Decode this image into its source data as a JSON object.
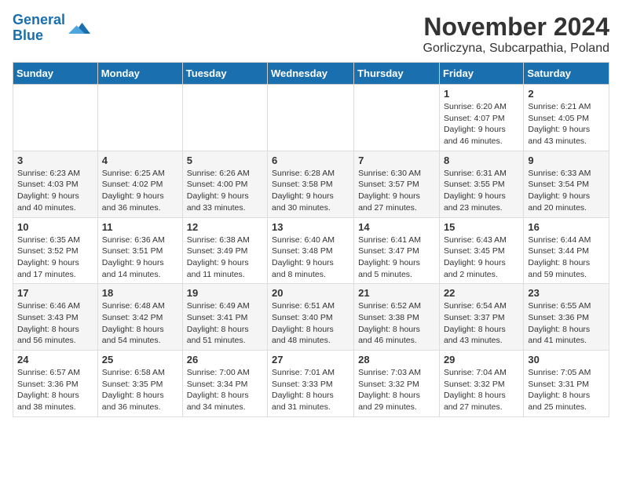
{
  "logo": {
    "line1": "General",
    "line2": "Blue"
  },
  "title": "November 2024",
  "subtitle": "Gorliczyna, Subcarpathia, Poland",
  "days_of_week": [
    "Sunday",
    "Monday",
    "Tuesday",
    "Wednesday",
    "Thursday",
    "Friday",
    "Saturday"
  ],
  "weeks": [
    [
      {
        "day": "",
        "info": ""
      },
      {
        "day": "",
        "info": ""
      },
      {
        "day": "",
        "info": ""
      },
      {
        "day": "",
        "info": ""
      },
      {
        "day": "",
        "info": ""
      },
      {
        "day": "1",
        "info": "Sunrise: 6:20 AM\nSunset: 4:07 PM\nDaylight: 9 hours and 46 minutes."
      },
      {
        "day": "2",
        "info": "Sunrise: 6:21 AM\nSunset: 4:05 PM\nDaylight: 9 hours and 43 minutes."
      }
    ],
    [
      {
        "day": "3",
        "info": "Sunrise: 6:23 AM\nSunset: 4:03 PM\nDaylight: 9 hours and 40 minutes."
      },
      {
        "day": "4",
        "info": "Sunrise: 6:25 AM\nSunset: 4:02 PM\nDaylight: 9 hours and 36 minutes."
      },
      {
        "day": "5",
        "info": "Sunrise: 6:26 AM\nSunset: 4:00 PM\nDaylight: 9 hours and 33 minutes."
      },
      {
        "day": "6",
        "info": "Sunrise: 6:28 AM\nSunset: 3:58 PM\nDaylight: 9 hours and 30 minutes."
      },
      {
        "day": "7",
        "info": "Sunrise: 6:30 AM\nSunset: 3:57 PM\nDaylight: 9 hours and 27 minutes."
      },
      {
        "day": "8",
        "info": "Sunrise: 6:31 AM\nSunset: 3:55 PM\nDaylight: 9 hours and 23 minutes."
      },
      {
        "day": "9",
        "info": "Sunrise: 6:33 AM\nSunset: 3:54 PM\nDaylight: 9 hours and 20 minutes."
      }
    ],
    [
      {
        "day": "10",
        "info": "Sunrise: 6:35 AM\nSunset: 3:52 PM\nDaylight: 9 hours and 17 minutes."
      },
      {
        "day": "11",
        "info": "Sunrise: 6:36 AM\nSunset: 3:51 PM\nDaylight: 9 hours and 14 minutes."
      },
      {
        "day": "12",
        "info": "Sunrise: 6:38 AM\nSunset: 3:49 PM\nDaylight: 9 hours and 11 minutes."
      },
      {
        "day": "13",
        "info": "Sunrise: 6:40 AM\nSunset: 3:48 PM\nDaylight: 9 hours and 8 minutes."
      },
      {
        "day": "14",
        "info": "Sunrise: 6:41 AM\nSunset: 3:47 PM\nDaylight: 9 hours and 5 minutes."
      },
      {
        "day": "15",
        "info": "Sunrise: 6:43 AM\nSunset: 3:45 PM\nDaylight: 9 hours and 2 minutes."
      },
      {
        "day": "16",
        "info": "Sunrise: 6:44 AM\nSunset: 3:44 PM\nDaylight: 8 hours and 59 minutes."
      }
    ],
    [
      {
        "day": "17",
        "info": "Sunrise: 6:46 AM\nSunset: 3:43 PM\nDaylight: 8 hours and 56 minutes."
      },
      {
        "day": "18",
        "info": "Sunrise: 6:48 AM\nSunset: 3:42 PM\nDaylight: 8 hours and 54 minutes."
      },
      {
        "day": "19",
        "info": "Sunrise: 6:49 AM\nSunset: 3:41 PM\nDaylight: 8 hours and 51 minutes."
      },
      {
        "day": "20",
        "info": "Sunrise: 6:51 AM\nSunset: 3:40 PM\nDaylight: 8 hours and 48 minutes."
      },
      {
        "day": "21",
        "info": "Sunrise: 6:52 AM\nSunset: 3:38 PM\nDaylight: 8 hours and 46 minutes."
      },
      {
        "day": "22",
        "info": "Sunrise: 6:54 AM\nSunset: 3:37 PM\nDaylight: 8 hours and 43 minutes."
      },
      {
        "day": "23",
        "info": "Sunrise: 6:55 AM\nSunset: 3:36 PM\nDaylight: 8 hours and 41 minutes."
      }
    ],
    [
      {
        "day": "24",
        "info": "Sunrise: 6:57 AM\nSunset: 3:36 PM\nDaylight: 8 hours and 38 minutes."
      },
      {
        "day": "25",
        "info": "Sunrise: 6:58 AM\nSunset: 3:35 PM\nDaylight: 8 hours and 36 minutes."
      },
      {
        "day": "26",
        "info": "Sunrise: 7:00 AM\nSunset: 3:34 PM\nDaylight: 8 hours and 34 minutes."
      },
      {
        "day": "27",
        "info": "Sunrise: 7:01 AM\nSunset: 3:33 PM\nDaylight: 8 hours and 31 minutes."
      },
      {
        "day": "28",
        "info": "Sunrise: 7:03 AM\nSunset: 3:32 PM\nDaylight: 8 hours and 29 minutes."
      },
      {
        "day": "29",
        "info": "Sunrise: 7:04 AM\nSunset: 3:32 PM\nDaylight: 8 hours and 27 minutes."
      },
      {
        "day": "30",
        "info": "Sunrise: 7:05 AM\nSunset: 3:31 PM\nDaylight: 8 hours and 25 minutes."
      }
    ]
  ]
}
